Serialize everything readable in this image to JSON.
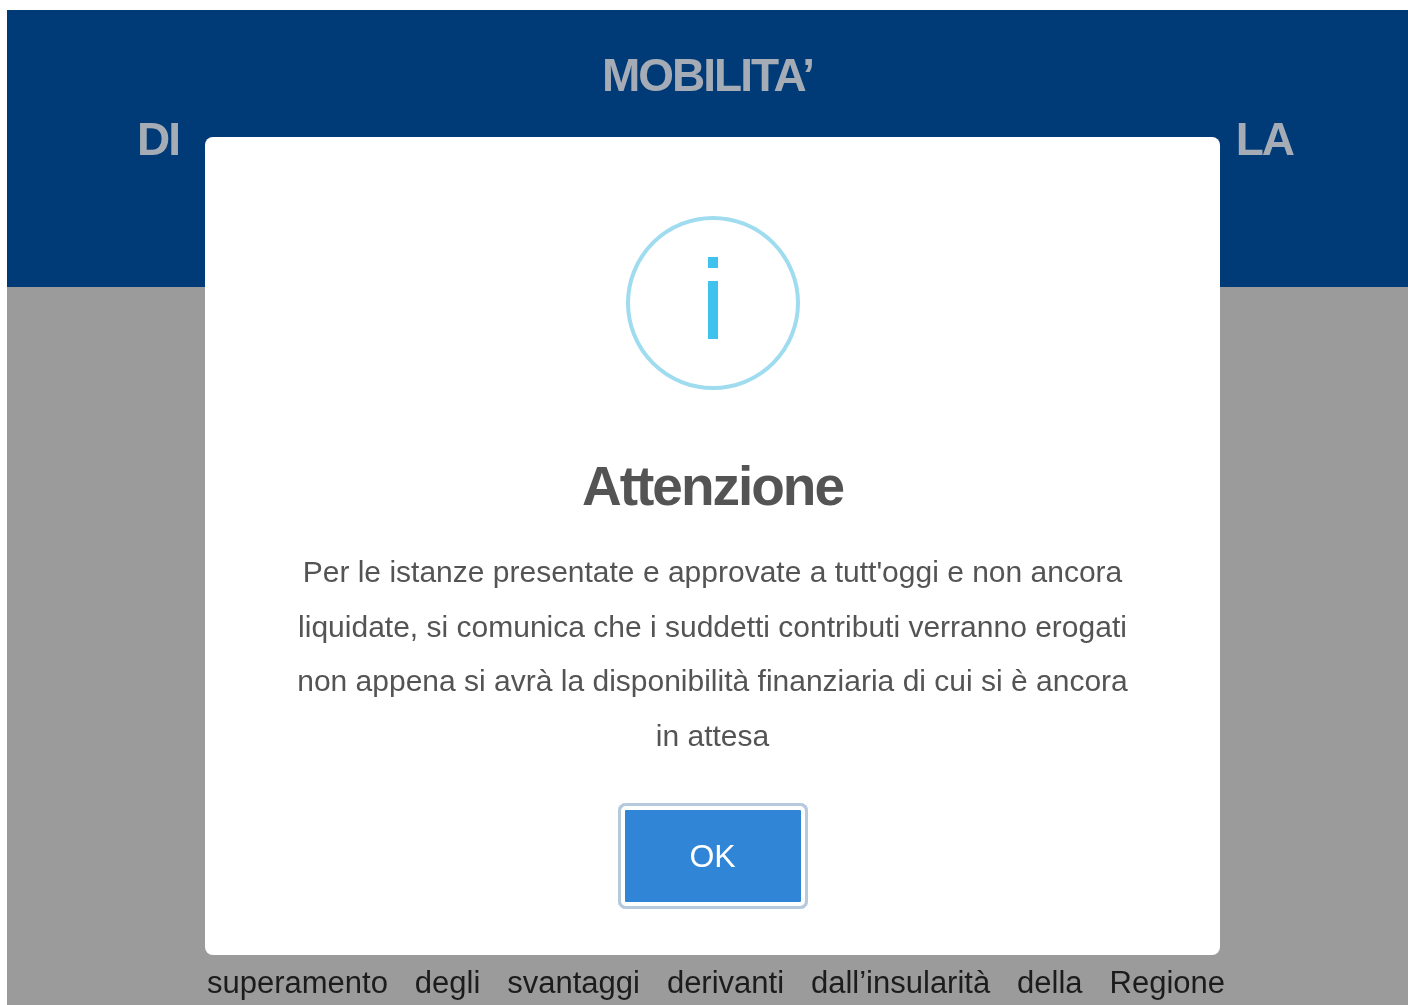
{
  "header": {
    "title": "MOBILITA’",
    "covered_line": {
      "left": "DI",
      "right": "LA"
    }
  },
  "page": {
    "paragraph": "superamento degli svantaggi derivanti dall’insularità della Regione"
  },
  "dialog": {
    "title": "Attenzione",
    "message": "Per le istanze presentate e approvate a tutt'oggi e non ancora liquidate, si comunica che i suddetti contributi verranno erogati non appena si avrà la disponibilità finanziaria di cui si è ancora in attesa",
    "button": {
      "label": "OK",
      "focused": true
    }
  }
}
